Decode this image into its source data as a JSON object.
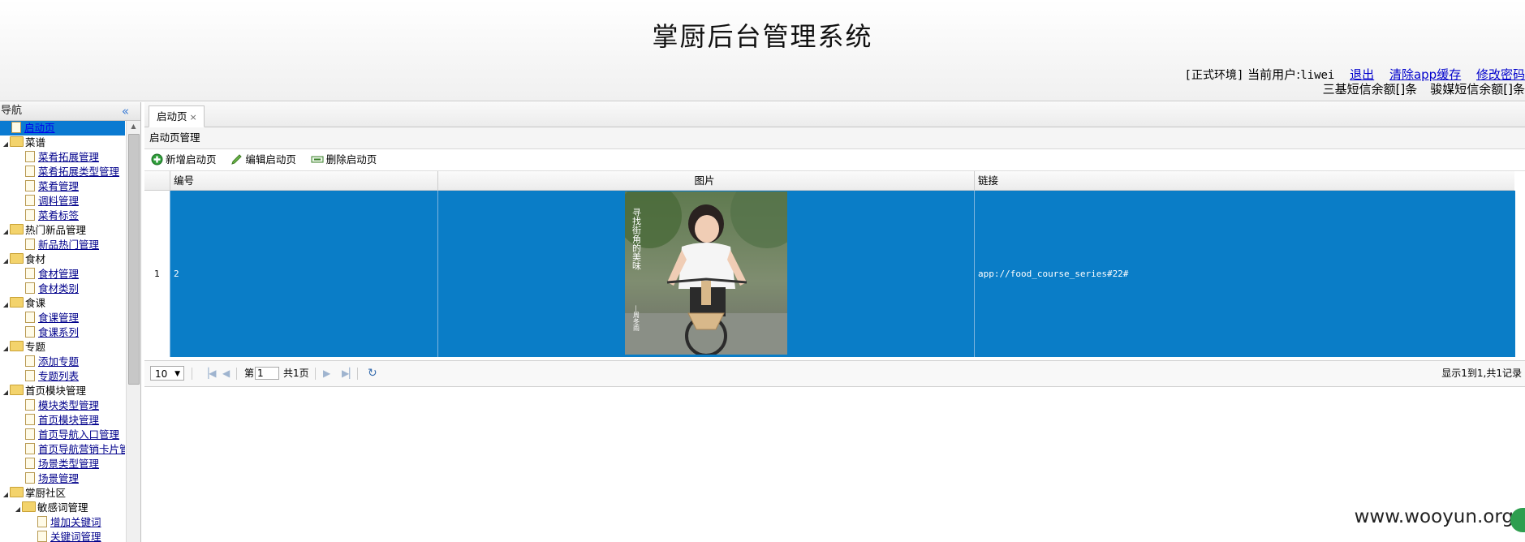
{
  "header": {
    "title": "掌厨后台管理系统",
    "env": "[正式环境]",
    "user_prefix": "当前用户:",
    "user_id": "liwei",
    "logout": "退出",
    "clear_cache": "清除app缓存",
    "change_password": "修改密码",
    "sms_sanji": "三基短信余额[]条",
    "sms_junmei": "骏媒短信余额[]条"
  },
  "nav": {
    "title": "导航",
    "collapse_icon": "«",
    "items": [
      {
        "label": "启动页",
        "type": "file",
        "level": 0,
        "selected": true
      },
      {
        "label": "菜谱",
        "type": "folder",
        "level": 0
      },
      {
        "label": "菜肴拓展管理",
        "type": "file",
        "level": 1
      },
      {
        "label": "菜肴拓展类型管理",
        "type": "file",
        "level": 1
      },
      {
        "label": "菜肴管理",
        "type": "file",
        "level": 1
      },
      {
        "label": "调料管理",
        "type": "file",
        "level": 1
      },
      {
        "label": "菜肴标签",
        "type": "file",
        "level": 1
      },
      {
        "label": "热门新品管理",
        "type": "folder",
        "level": 0
      },
      {
        "label": "新品热门管理",
        "type": "file",
        "level": 1
      },
      {
        "label": "食材",
        "type": "folder",
        "level": 0
      },
      {
        "label": "食材管理",
        "type": "file",
        "level": 1
      },
      {
        "label": "食材类别",
        "type": "file",
        "level": 1
      },
      {
        "label": "食课",
        "type": "folder",
        "level": 0
      },
      {
        "label": "食课管理",
        "type": "file",
        "level": 1
      },
      {
        "label": "食课系列",
        "type": "file",
        "level": 1
      },
      {
        "label": "专题",
        "type": "folder",
        "level": 0
      },
      {
        "label": "添加专题",
        "type": "file",
        "level": 1
      },
      {
        "label": "专题列表",
        "type": "file",
        "level": 1
      },
      {
        "label": "首页模块管理",
        "type": "folder",
        "level": 0
      },
      {
        "label": "模块类型管理",
        "type": "file",
        "level": 1
      },
      {
        "label": "首页模块管理",
        "type": "file",
        "level": 1
      },
      {
        "label": "首页导航入口管理",
        "type": "file",
        "level": 1
      },
      {
        "label": "首页导航营销卡片管",
        "type": "file",
        "level": 1
      },
      {
        "label": "场景类型管理",
        "type": "file",
        "level": 1
      },
      {
        "label": "场景管理",
        "type": "file",
        "level": 1
      },
      {
        "label": "掌厨社区",
        "type": "folder",
        "level": 0
      },
      {
        "label": "敏感词管理",
        "type": "folder",
        "level": 1
      },
      {
        "label": "增加关键词",
        "type": "file",
        "level": 2
      },
      {
        "label": "关键词管理",
        "type": "file",
        "level": 2
      }
    ]
  },
  "tabs": [
    {
      "label": "启动页",
      "close": "×"
    }
  ],
  "panel": {
    "title": "启动页管理",
    "toolbar": {
      "add": "新增启动页",
      "edit": "编辑启动页",
      "delete": "删除启动页"
    }
  },
  "grid": {
    "columns": [
      "编号",
      "图片",
      "链接"
    ],
    "rows": [
      {
        "rownum": "1",
        "id": "2",
        "link": "app://food_course_series#22#",
        "image": "photo-woman-bicycle",
        "poster_text": "寻找街角的美味",
        "poster_author": "—周冬雨"
      }
    ]
  },
  "pager": {
    "page_size": "10",
    "page_prefix": "第",
    "page_value": "1",
    "page_suffix": "共1页",
    "info": "显示1到1,共1记录"
  },
  "watermark": "www.wooyun.org",
  "colors": {
    "selected_row": "#0a7dc7",
    "nav_selected": "#0a7ad1",
    "link": "#0000cc"
  }
}
